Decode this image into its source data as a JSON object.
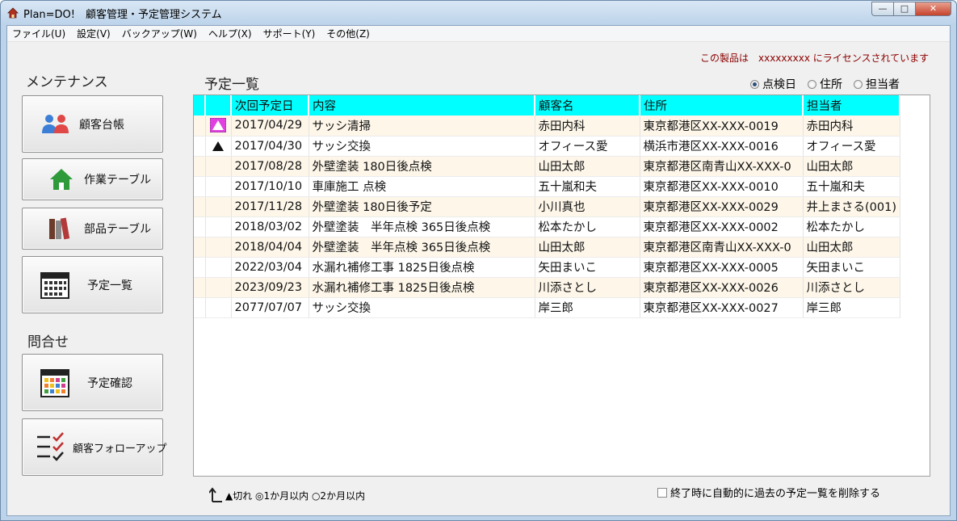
{
  "window": {
    "title": "Plan=DO!　顧客管理・予定管理システム"
  },
  "menu": [
    "ファイル(U)",
    "設定(V)",
    "バックアップ(W)",
    "ヘルプ(X)",
    "サポート(Y)",
    "その他(Z)"
  ],
  "license": {
    "text": "この製品は　xxxxxxxxx にライセンスされています"
  },
  "sidebar": {
    "maintenance_label": "メンテナンス",
    "inquiry_label": "問合せ",
    "buttons": {
      "customer": "顧客台帳",
      "work": "作業テーブル",
      "parts": "部品テーブル",
      "schedule": "予定一覧",
      "confirm": "予定確認",
      "followup": "顧客フォローアップ"
    }
  },
  "list": {
    "title": "予定一覧",
    "sort_options": [
      "点検日",
      "住所",
      "担当者"
    ],
    "sort_selected": "点検日",
    "columns": [
      "次回予定日",
      "内容",
      "顧客名",
      "住所",
      "担当者"
    ],
    "rows": [
      {
        "mark": "expired-selected",
        "date": "2017/04/29",
        "content": "サッシ清掃",
        "customer": "赤田内科",
        "address": "東京都港区XX-XXX-0019",
        "staff": "赤田内科"
      },
      {
        "mark": "expired",
        "date": "2017/04/30",
        "content": "サッシ交換",
        "customer": "オフィース愛",
        "address": "横浜市港区XX-XXX-0016",
        "staff": "オフィース愛"
      },
      {
        "mark": "",
        "date": "2017/08/28",
        "content": "外壁塗装 180日後点検",
        "customer": "山田太郎",
        "address": "東京都港区南青山XX-XXX-0",
        "staff": "山田太郎"
      },
      {
        "mark": "",
        "date": "2017/10/10",
        "content": "車庫施工 点検",
        "customer": "五十嵐和夫",
        "address": "東京都港区XX-XXX-0010",
        "staff": "五十嵐和夫"
      },
      {
        "mark": "",
        "date": "2017/11/28",
        "content": "外壁塗装 180日後予定",
        "customer": "小川真也",
        "address": "東京都港区XX-XXX-0029",
        "staff": "井上まさる(001)"
      },
      {
        "mark": "",
        "date": "2018/03/02",
        "content": "外壁塗装　半年点検 365日後点検",
        "customer": "松本たかし",
        "address": "東京都港区XX-XXX-0002",
        "staff": "松本たかし"
      },
      {
        "mark": "",
        "date": "2018/04/04",
        "content": "外壁塗装　半年点検 365日後点検",
        "customer": "山田太郎",
        "address": "東京都港区南青山XX-XXX-0",
        "staff": "山田太郎"
      },
      {
        "mark": "",
        "date": "2022/03/04",
        "content": "水漏れ補修工事 1825日後点検",
        "customer": "矢田まいこ",
        "address": "東京都港区XX-XXX-0005",
        "staff": "矢田まいこ"
      },
      {
        "mark": "",
        "date": "2023/09/23",
        "content": "水漏れ補修工事 1825日後点検",
        "customer": "川添さとし",
        "address": "東京都港区XX-XXX-0026",
        "staff": "川添さとし"
      },
      {
        "mark": "",
        "date": "2077/07/07",
        "content": "サッシ交換",
        "customer": "岸三郎",
        "address": "東京都港区XX-XXX-0027",
        "staff": "岸三郎"
      }
    ]
  },
  "legend": {
    "text": "▲切れ ◎1か月以内 ○2か月以内"
  },
  "auto_delete": {
    "label": "終了時に自動的に過去の予定一覧を削除する",
    "checked": false
  },
  "colors": {
    "header": "#00ffff",
    "alt_row": "#fdf6e9",
    "license": "#8b0000",
    "selected_mark": "#e040e0"
  }
}
